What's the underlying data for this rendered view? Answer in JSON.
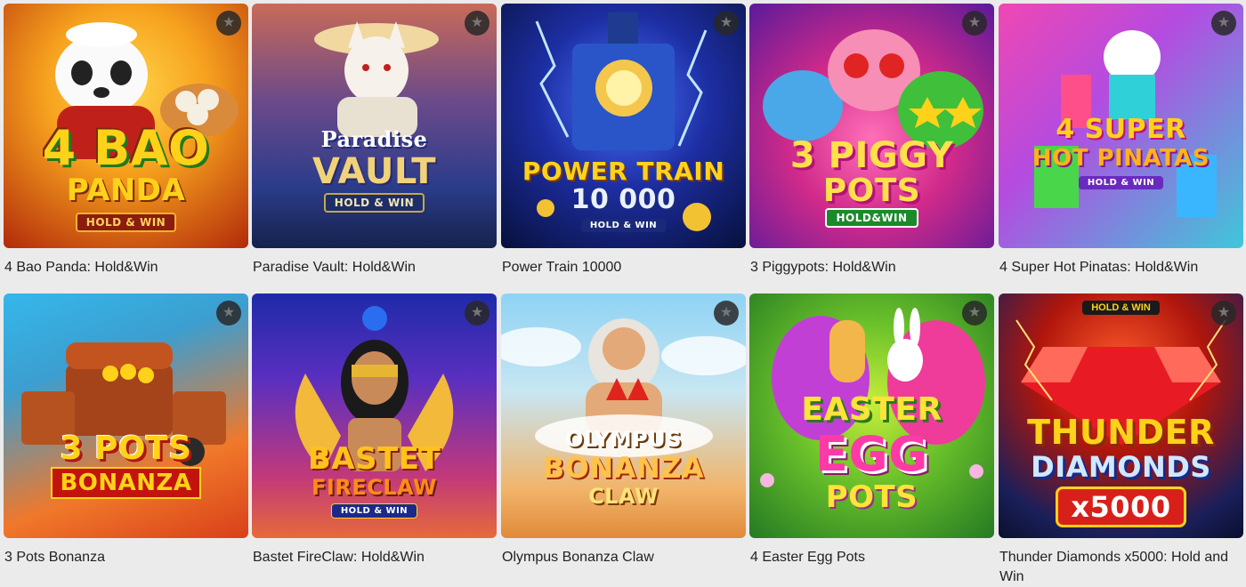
{
  "favorite_icon": "star-icon",
  "games": [
    {
      "name": "4 Bao Panda: Hold&Win",
      "logo": {
        "line1": "4 BAO",
        "line2": "PANDA",
        "badge": "HOLD & WIN"
      },
      "colors": {
        "bg1": "#f7b41e",
        "bg2": "#b22a0a"
      }
    },
    {
      "name": "Paradise Vault: Hold&Win",
      "logo": {
        "line1": "Paradise",
        "line2": "VAULT",
        "badge": "HOLD & WIN"
      },
      "colors": {
        "bg1": "#3a4a9a",
        "bg2": "#1c2a55"
      }
    },
    {
      "name": "Power Train 10000",
      "logo": {
        "line1": "POWER TRAIN",
        "line2": "10 000",
        "badge": "HOLD & WIN"
      },
      "colors": {
        "bg1": "#2b3cc7",
        "bg2": "#0b1247"
      }
    },
    {
      "name": "3 Piggypots: Hold&Win",
      "logo": {
        "line1": "3 PIGGY",
        "line2": "POTS",
        "badge": "HOLD&WIN"
      },
      "colors": {
        "bg1": "#e0338f",
        "bg2": "#f1a11f"
      }
    },
    {
      "name": "4 Super Hot Pinatas: Hold&Win",
      "logo": {
        "line1": "4 SUPER",
        "line2": "HOT PINATAS",
        "badge": "HOLD & WIN"
      },
      "colors": {
        "bg1": "#e24bb4",
        "bg2": "#26c3d8"
      }
    },
    {
      "name": "3 Pots Bonanza",
      "logo": {
        "line1": "3 POTS",
        "line2": "BONANZA",
        "badge": ""
      },
      "colors": {
        "bg1": "#2aa9dd",
        "bg2": "#e6541b"
      }
    },
    {
      "name": "Bastet FireClaw: Hold&Win",
      "logo": {
        "line1": "BASTET",
        "line2": "FIRECLAW",
        "badge": "HOLD & WIN"
      },
      "colors": {
        "bg1": "#2b2ab0",
        "bg2": "#c43b6a"
      }
    },
    {
      "name": "Olympus Bonanza Claw",
      "logo": {
        "line1": "OLYMPUS",
        "line2": "BONANZA",
        "line3": "CLAW",
        "badge": ""
      },
      "colors": {
        "bg1": "#7cc6ef",
        "bg2": "#e9a25a"
      }
    },
    {
      "name": "4 Easter Egg Pots",
      "logo": {
        "line1": "EASTER",
        "line2": "EGG",
        "line3": "POTS",
        "badge": ""
      },
      "colors": {
        "bg1": "#9ad02a",
        "bg2": "#2e8e2a"
      }
    },
    {
      "name": "Thunder Diamonds x5000: Hold and Win",
      "logo": {
        "line1": "THUNDER",
        "line2": "DIAMONDS",
        "line3": "x5000",
        "badge": "HOLD & WIN"
      },
      "colors": {
        "bg1": "#e3321d",
        "bg2": "#0b1a4a"
      }
    }
  ]
}
